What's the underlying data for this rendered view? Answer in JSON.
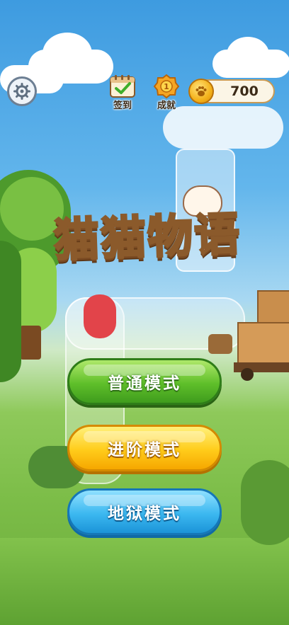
{
  "game_title": "猫猫物语",
  "top_bar": {
    "settings_icon": "gear-icon",
    "checkin": {
      "label": "签到",
      "icon": "calendar-check-icon"
    },
    "achievement": {
      "label": "成就",
      "icon": "trophy-badge-icon"
    },
    "coins": {
      "value": "700",
      "icon": "paw-coin-icon"
    }
  },
  "modes": [
    {
      "label": "普通模式",
      "color": "#5fbf2a"
    },
    {
      "label": "进阶模式",
      "color": "#ffcc1a"
    },
    {
      "label": "地狱模式",
      "color": "#3cb8f0"
    }
  ],
  "colors": {
    "title_fill": "#f5a7c8",
    "title_stroke": "#8b5a2b",
    "coin": "#f4b21b"
  }
}
